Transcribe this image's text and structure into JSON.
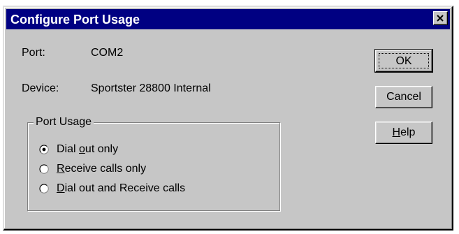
{
  "dialog": {
    "title": "Configure Port Usage"
  },
  "info": {
    "port_label": "Port:",
    "port_value": "COM2",
    "device_label": "Device:",
    "device_value": "Sportster 28800 Internal"
  },
  "port_usage": {
    "legend": "Port Usage",
    "options": [
      {
        "pre": "Dial ",
        "accel": "o",
        "post": "ut only",
        "selected": true
      },
      {
        "pre": "",
        "accel": "R",
        "post": "eceive calls only",
        "selected": false
      },
      {
        "pre": "",
        "accel": "D",
        "post": "ial out and Receive calls",
        "selected": false
      }
    ]
  },
  "buttons": {
    "ok": "OK",
    "cancel": "Cancel",
    "help_accel": "H",
    "help_rest": "elp"
  },
  "icons": {
    "close": "close-icon"
  }
}
